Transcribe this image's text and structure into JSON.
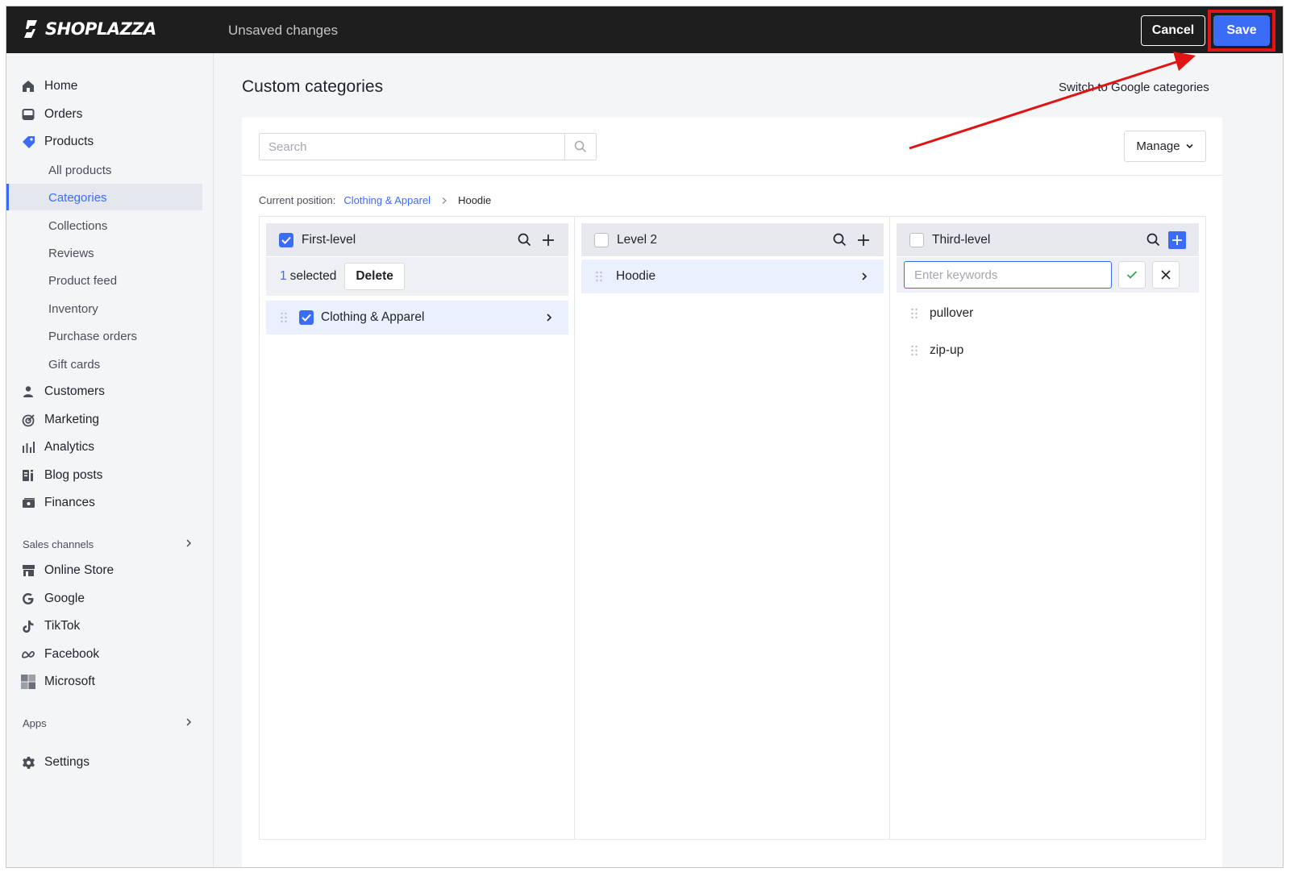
{
  "app": {
    "brand": "SHOPLAZZA",
    "status": "Unsaved changes",
    "cancel_label": "Cancel",
    "save_label": "Save"
  },
  "sidebar": {
    "items": [
      {
        "label": "Home",
        "icon": "home-icon"
      },
      {
        "label": "Orders",
        "icon": "inbox-icon"
      },
      {
        "label": "Products",
        "icon": "tag-icon"
      }
    ],
    "product_sub": [
      {
        "label": "All products"
      },
      {
        "label": "Categories",
        "active": true
      },
      {
        "label": "Collections"
      },
      {
        "label": "Reviews"
      },
      {
        "label": "Product feed"
      },
      {
        "label": "Inventory"
      },
      {
        "label": "Purchase orders"
      },
      {
        "label": "Gift cards"
      }
    ],
    "items2": [
      {
        "label": "Customers",
        "icon": "person-icon"
      },
      {
        "label": "Marketing",
        "icon": "target-icon"
      },
      {
        "label": "Analytics",
        "icon": "bar-chart-icon"
      },
      {
        "label": "Blog posts",
        "icon": "blog-icon"
      },
      {
        "label": "Finances",
        "icon": "finance-icon"
      }
    ],
    "sales_channels_label": "Sales channels",
    "channels": [
      {
        "label": "Online Store",
        "icon": "store-icon"
      },
      {
        "label": "Google",
        "icon": "google-icon"
      },
      {
        "label": "TikTok",
        "icon": "tiktok-icon"
      },
      {
        "label": "Facebook",
        "icon": "meta-icon"
      },
      {
        "label": "Microsoft",
        "icon": "microsoft-icon"
      }
    ],
    "apps_label": "Apps",
    "settings_label": "Settings"
  },
  "main": {
    "title": "Custom categories",
    "switch_link": "Switch to Google categories",
    "search_placeholder": "Search",
    "manage_label": "Manage",
    "breadcrumb": {
      "label": "Current position:",
      "parent": "Clothing & Apparel",
      "current": "Hoodie"
    },
    "columns": {
      "first": {
        "title": "First-level",
        "checked": true,
        "selected_count": "1",
        "selected_suffix": "selected",
        "delete_label": "Delete",
        "rows": [
          {
            "label": "Clothing & Apparel",
            "checked": true
          }
        ]
      },
      "second": {
        "title": "Level 2",
        "checked": false,
        "rows": [
          {
            "label": "Hoodie"
          }
        ]
      },
      "third": {
        "title": "Third-level",
        "checked": false,
        "input_placeholder": "Enter keywords",
        "rows": [
          {
            "label": "pullover"
          },
          {
            "label": "zip-up"
          }
        ]
      }
    }
  },
  "colors": {
    "accent": "#3b6cf6",
    "topbar": "#1e1e1e",
    "annotation": "#e01414"
  }
}
